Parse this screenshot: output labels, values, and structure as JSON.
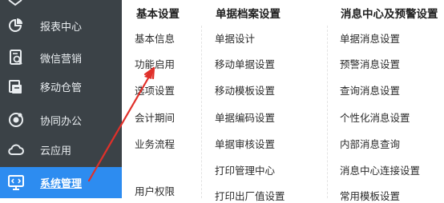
{
  "sidebar": {
    "items": [
      {
        "label": "报表中心",
        "icon": "pie-chart-icon"
      },
      {
        "label": "微信营销",
        "icon": "wechat-doc-icon"
      },
      {
        "label": "移动仓管",
        "icon": "mobile-warehouse-icon"
      },
      {
        "label": "协同办公",
        "icon": "collaboration-icon"
      },
      {
        "label": "云应用",
        "icon": "cloud-icon"
      },
      {
        "label": "系统管理",
        "icon": "system-monitor-icon",
        "active": true
      }
    ],
    "colors": {
      "background": "#3b4247",
      "active": "#2d8cf0"
    }
  },
  "menu": {
    "basic": {
      "title": "基本设置",
      "items": [
        "基本信息",
        "功能启用",
        "选项设置",
        "会计期间",
        "业务流程",
        "用户权限"
      ]
    },
    "documents": {
      "title": "单据档案设置",
      "items": [
        "单据设计",
        "移动单据设置",
        "移动模板设置",
        "单据编码设置",
        "单据审核设置",
        "打印管理中心",
        "打印出厂值设置"
      ]
    },
    "messages": {
      "title": "消息中心及预警设置",
      "items": [
        "单据消息设置",
        "预警消息设置",
        "查询消息设置",
        "个性化消息设置",
        "内部消息查询",
        "消息中心连接设置",
        "常用模板设置"
      ]
    }
  },
  "annotation": {
    "arrow_color": "#e0302a",
    "points_to": "功能启用"
  }
}
